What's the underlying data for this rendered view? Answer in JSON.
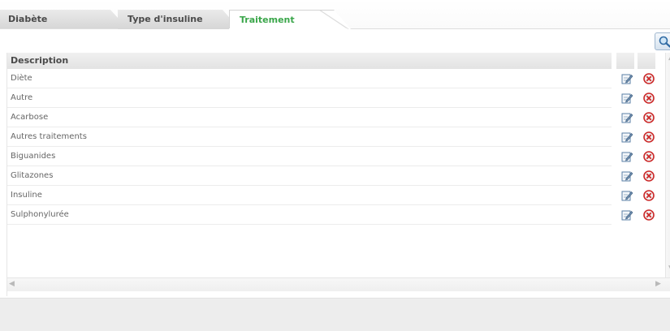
{
  "tabs": [
    {
      "label": "Diabète",
      "active": false
    },
    {
      "label": "Type d'insuline",
      "active": false
    },
    {
      "label": "Traitement",
      "active": true
    }
  ],
  "toolbar": {
    "search_icon": "search-icon"
  },
  "grid": {
    "header": {
      "description": "Description"
    },
    "rows": [
      {
        "description": "Diète"
      },
      {
        "description": "Autre"
      },
      {
        "description": "Acarbose"
      },
      {
        "description": "Autres traitements"
      },
      {
        "description": "Biguanides"
      },
      {
        "description": "Glitazones"
      },
      {
        "description": "Insuline"
      },
      {
        "description": "Sulphonylurée"
      }
    ],
    "row_actions": {
      "edit_icon": "edit-icon",
      "delete_icon": "delete-icon"
    }
  },
  "colors": {
    "active_tab_text": "#3aa64a",
    "delete_icon": "#cc2a2a",
    "edit_icon": "#5a7fa6"
  }
}
